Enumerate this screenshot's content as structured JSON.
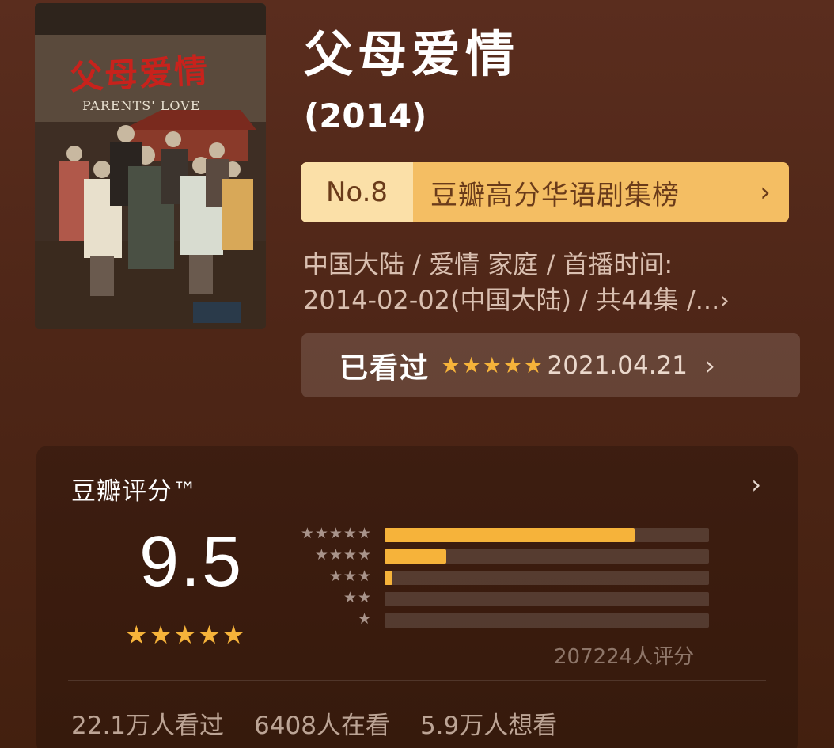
{
  "poster": {
    "title": "父母爱情",
    "subtitle": "PARENTS' LOVE"
  },
  "title": "父母爱情",
  "year": "(2014)",
  "rank": {
    "number": "No.8",
    "list_name": "豆瓣高分华语剧集榜",
    "chevron": "›"
  },
  "meta": {
    "line1": "中国大陆 / 爱情 家庭 / 首播时间:",
    "line2": "2014-02-02(中国大陆) / 共44集 /...›"
  },
  "watched": {
    "label": "已看过",
    "stars": "★★★★★",
    "date": "2021.04.21",
    "chevron": "›"
  },
  "rating": {
    "title": "豆瓣评分™",
    "chevron": "›",
    "score": "9.5",
    "stars": "★★★★★",
    "count_text": "207224人评分",
    "distribution": [
      {
        "stars": "★★★★★",
        "fraction": 0.77
      },
      {
        "stars": "★★★★",
        "fraction": 0.19
      },
      {
        "stars": "★★★",
        "fraction": 0.025
      },
      {
        "stars": "★★",
        "fraction": 0.0
      },
      {
        "stars": "★",
        "fraction": 0.0
      }
    ]
  },
  "stats": {
    "watched": "22.1万人看过",
    "watching": "6408人在看",
    "wish": "5.9万人想看"
  },
  "colors": {
    "background": "#4e2617",
    "accent_gold": "#f6b33a",
    "rank_banner": "#f4be63",
    "rank_text": "#6a3b1a"
  }
}
